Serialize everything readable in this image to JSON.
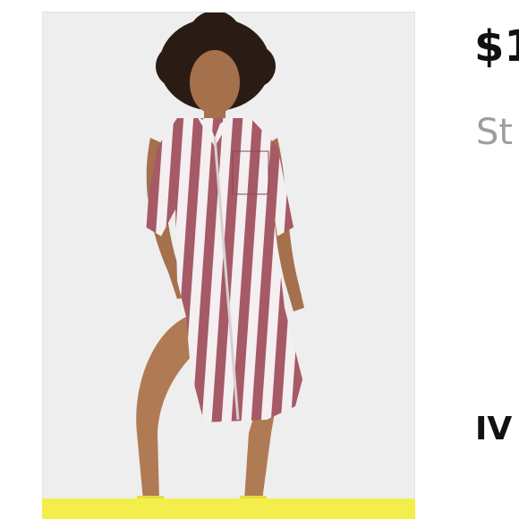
{
  "listing": {
    "price": "$1",
    "size": "St",
    "brand": "IV",
    "image": {
      "icon": "product-photo-striped-shirt-dress",
      "stripe_color": "#a55a66",
      "strip_color": "#f3ee4c"
    }
  }
}
